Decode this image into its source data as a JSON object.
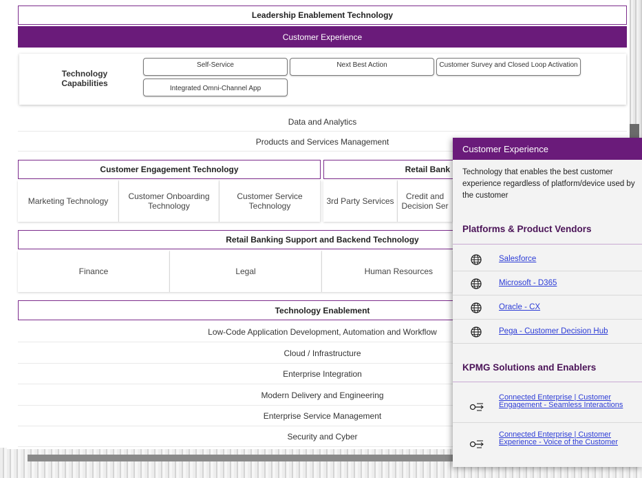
{
  "header": {
    "title": "Leadership Enablement Technology",
    "banner": "Customer Experience"
  },
  "capabilities": {
    "label": "Technology Capabilities",
    "items": [
      "Self-Service",
      "Next Best Action",
      "Customer Survey and Closed Loop Activation",
      "Integrated Omni-Channel App"
    ]
  },
  "bands": [
    "Data and Analytics",
    "Products and Services Management"
  ],
  "engagement": {
    "title": "Customer Engagement Technology",
    "cells": [
      "Marketing Technology",
      "Customer Onboarding Technology",
      "Customer Service Technology"
    ]
  },
  "retail": {
    "title": "Retail Bank",
    "cells": [
      "3rd Party Services",
      "Credit and Decision Ser"
    ]
  },
  "support": {
    "title": "Retail Banking Support and Backend Technology",
    "cells": [
      "Finance",
      "Legal",
      "Human Resources"
    ]
  },
  "enablement": {
    "title": "Technology Enablement",
    "rows": [
      "Low-Code Application Development, Automation and Workflow",
      "Cloud / Infrastructure",
      "Enterprise Integration",
      "Modern Delivery and Engineering",
      "Enterprise Service Management",
      "Security and Cyber"
    ]
  },
  "popover": {
    "title": "Customer Experience",
    "description": "Technology that enables the best customer experience regardless of platform/device used by the customer",
    "vendors_heading": "Platforms & Product Vendors",
    "vendors": [
      "Salesforce",
      "Microsoft - D365",
      "Oracle - CX",
      "Pega - Customer Decision Hub"
    ],
    "solutions_heading": "KPMG Solutions and Enablers",
    "solutions": [
      "Connected Enterprise | Customer Engagement - Seamless Interactions",
      "Connected Enterprise | Customer Experience - Voice of the Customer"
    ]
  },
  "colors": {
    "brand_purple": "#6a1b7a",
    "link_blue": "#2b3bd6"
  }
}
